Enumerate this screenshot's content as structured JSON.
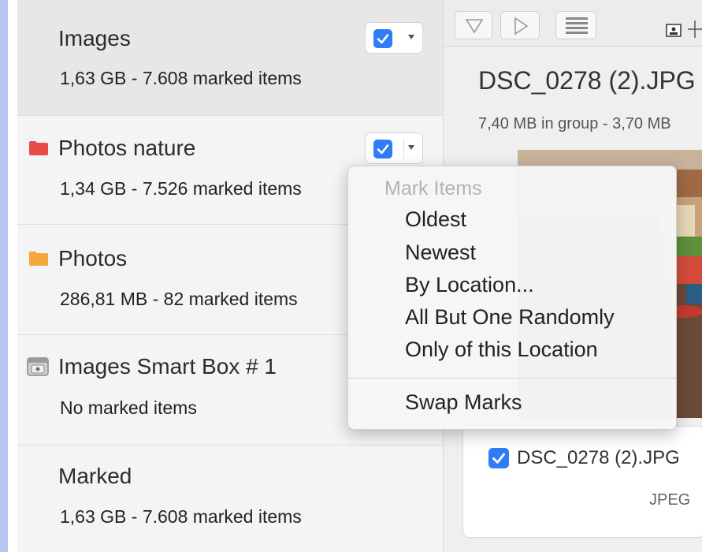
{
  "sidebar": {
    "groups": [
      {
        "title": "Images",
        "subtitle": "1,63 GB - 7.608 marked items",
        "checked": true
      },
      {
        "title": "Photos nature",
        "subtitle": "1,34 GB - 7.526 marked items",
        "icon": "folder-icon",
        "icon_color": "#e94a4a",
        "checked": true
      },
      {
        "title": "Photos",
        "subtitle": "286,81 MB - 82 marked items",
        "icon": "folder-icon",
        "icon_color": "#f3a73c"
      },
      {
        "title": "Images Smart Box # 1",
        "subtitle": "No marked items",
        "icon": "smartbox-icon"
      },
      {
        "title": "Marked",
        "subtitle": "1,63 GB - 7.608 marked items"
      }
    ]
  },
  "detail": {
    "file_title": "DSC_0278 (2).JPG",
    "file_subtitle": "7,40 MB in group - 3,70 MB",
    "card_name": "DSC_0278 (2).JPG",
    "card_type": "JPEG",
    "card_checked": true
  },
  "menu": {
    "header": "Mark Items",
    "items": [
      "Oldest",
      "Newest",
      "By Location...",
      "All But One Randomly",
      "Only of this Location"
    ],
    "swap": "Swap Marks"
  },
  "colors": {
    "accent": "#2f7df6",
    "selected_row": "#e9e7e5",
    "sidebar_strip": "#b8c6f2"
  }
}
